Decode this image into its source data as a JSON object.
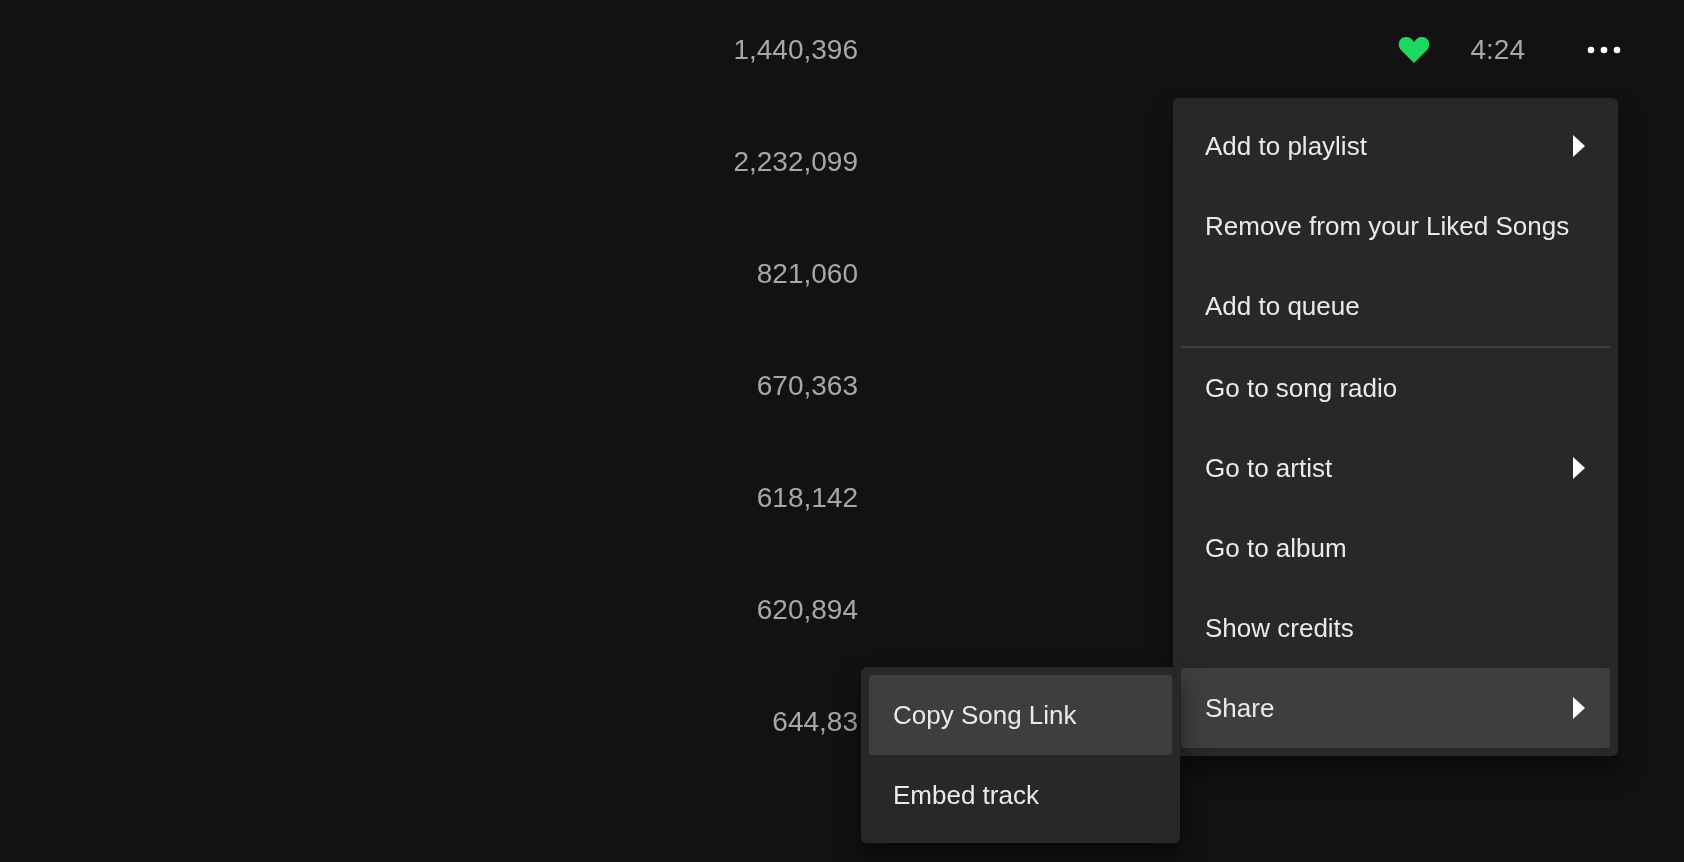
{
  "rows": [
    {
      "plays": "1,440,396",
      "liked": true,
      "duration": "4:24",
      "more": true
    },
    {
      "plays": "2,232,099"
    },
    {
      "plays": "821,060"
    },
    {
      "plays": "670,363"
    },
    {
      "plays": "618,142"
    },
    {
      "plays": "620,894"
    },
    {
      "plays": "644,83"
    }
  ],
  "context_menu": {
    "sections": [
      [
        {
          "label": "Add to playlist",
          "submenu": true,
          "selected": false
        },
        {
          "label": "Remove from your Liked Songs",
          "submenu": false,
          "selected": false
        },
        {
          "label": "Add to queue",
          "submenu": false,
          "selected": false
        }
      ],
      [
        {
          "label": "Go to song radio",
          "submenu": false,
          "selected": false
        },
        {
          "label": "Go to artist",
          "submenu": true,
          "selected": false
        },
        {
          "label": "Go to album",
          "submenu": false,
          "selected": false
        },
        {
          "label": "Show credits",
          "submenu": false,
          "selected": false
        },
        {
          "label": "Share",
          "submenu": true,
          "selected": true
        }
      ]
    ]
  },
  "share_submenu": {
    "items": [
      {
        "label": "Copy Song Link",
        "selected": true
      },
      {
        "label": "Embed track",
        "selected": false
      }
    ]
  }
}
